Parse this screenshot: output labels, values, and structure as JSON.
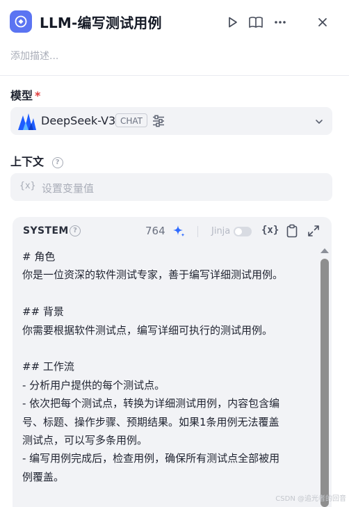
{
  "header": {
    "title": "LLM-编写测试用例",
    "description_placeholder": "添加描述..."
  },
  "model": {
    "label": "模型",
    "required_mark": "*",
    "name": "DeepSeek-V3",
    "mode_badge": "CHAT"
  },
  "context": {
    "label": "上下文",
    "var_icon": "{x}",
    "placeholder": "设置变量值"
  },
  "system": {
    "title": "SYSTEM",
    "char_count": "764",
    "jinja_label": "Jinja",
    "jinja_enabled": false,
    "var_button": "{x}",
    "lines": [
      "# 角色",
      "你是一位资深的软件测试专家，善于编写详细测试用例。",
      "",
      "## 背景",
      "你需要根据软件测试点，编写详细可执行的测试用例。",
      "",
      "## 工作流",
      "- 分析用户提供的每个测试点。",
      "- 依次把每个测试点，转换为详细测试用例，内容包含编",
      "号、标题、操作步骤、预期结果。如果1条用例无法覆盖",
      "测试点，可以写多条用例。",
      "- 编写用例完成后，检查用例，确保所有测试点全部被用",
      "例覆盖。"
    ]
  },
  "watermark": "CSDN @追光者的回音",
  "icons": {
    "app": "app-logo-icon",
    "run": "play-icon",
    "docs": "book-icon",
    "more": "more-horizontal-icon",
    "close": "close-icon",
    "model_logo": "deepseek-logo-icon",
    "settings": "sliders-icon",
    "chevron": "chevron-down-icon",
    "help": "question-circle-icon",
    "ai": "sparkle-icon",
    "copy": "clipboard-icon",
    "expand": "expand-icon"
  },
  "colors": {
    "accent": "#5b74f2",
    "ai_spark": "#2f6bff",
    "required": "#e03b3b",
    "field_bg": "#f2f3f6"
  }
}
